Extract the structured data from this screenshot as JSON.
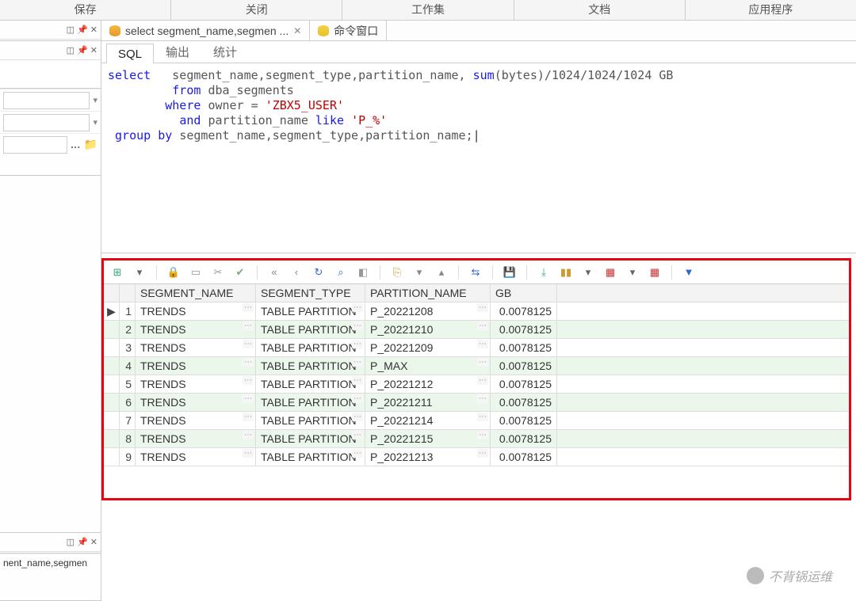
{
  "menubar": [
    "保存",
    "关闭",
    "工作集",
    "文档",
    "应用程序"
  ],
  "doc_tabs": [
    {
      "label": "select segment_name,segmen ...",
      "active": true,
      "closable": true
    },
    {
      "label": "命令窗口",
      "active": false,
      "closable": false
    }
  ],
  "sub_tabs": [
    {
      "label": "SQL",
      "active": true
    },
    {
      "label": "输出",
      "active": false
    },
    {
      "label": "统计",
      "active": false
    }
  ],
  "sql_tokens": [
    {
      "t": "kw",
      "v": "select"
    },
    {
      "t": "sp",
      "v": "   "
    },
    {
      "t": "ident",
      "v": "segment_name"
    },
    {
      "t": "lit",
      "v": ","
    },
    {
      "t": "ident",
      "v": "segment_type"
    },
    {
      "t": "lit",
      "v": ","
    },
    {
      "t": "ident",
      "v": "partition_name"
    },
    {
      "t": "lit",
      "v": ", "
    },
    {
      "t": "func",
      "v": "sum"
    },
    {
      "t": "lit",
      "v": "("
    },
    {
      "t": "ident",
      "v": "bytes"
    },
    {
      "t": "lit",
      "v": ")"
    },
    {
      "t": "lit",
      "v": "/"
    },
    {
      "t": "lit",
      "v": "1024"
    },
    {
      "t": "lit",
      "v": "/"
    },
    {
      "t": "lit",
      "v": "1024"
    },
    {
      "t": "lit",
      "v": "/"
    },
    {
      "t": "lit",
      "v": "1024"
    },
    {
      "t": "sp",
      "v": " "
    },
    {
      "t": "ident",
      "v": "GB"
    },
    {
      "t": "nl",
      "v": "\n"
    },
    {
      "t": "sp",
      "v": "         "
    },
    {
      "t": "kw",
      "v": "from"
    },
    {
      "t": "sp",
      "v": " "
    },
    {
      "t": "ident",
      "v": "dba_segments"
    },
    {
      "t": "nl",
      "v": "\n"
    },
    {
      "t": "sp",
      "v": "        "
    },
    {
      "t": "kw",
      "v": "where"
    },
    {
      "t": "sp",
      "v": " "
    },
    {
      "t": "ident",
      "v": "owner"
    },
    {
      "t": "sp",
      "v": " "
    },
    {
      "t": "lit",
      "v": "="
    },
    {
      "t": "sp",
      "v": " "
    },
    {
      "t": "str",
      "v": "'ZBX5_USER'"
    },
    {
      "t": "nl",
      "v": "\n"
    },
    {
      "t": "sp",
      "v": "          "
    },
    {
      "t": "kw",
      "v": "and"
    },
    {
      "t": "sp",
      "v": " "
    },
    {
      "t": "ident",
      "v": "partition_name"
    },
    {
      "t": "sp",
      "v": " "
    },
    {
      "t": "kw",
      "v": "like"
    },
    {
      "t": "sp",
      "v": " "
    },
    {
      "t": "str",
      "v": "'P_%'"
    },
    {
      "t": "nl",
      "v": "\n"
    },
    {
      "t": "sp",
      "v": " "
    },
    {
      "t": "kw",
      "v": "group"
    },
    {
      "t": "sp",
      "v": " "
    },
    {
      "t": "kw",
      "v": "by"
    },
    {
      "t": "sp",
      "v": " "
    },
    {
      "t": "ident",
      "v": "segment_name"
    },
    {
      "t": "lit",
      "v": ","
    },
    {
      "t": "ident",
      "v": "segment_type"
    },
    {
      "t": "lit",
      "v": ","
    },
    {
      "t": "ident",
      "v": "partition_name"
    },
    {
      "t": "lit",
      "v": ";"
    }
  ],
  "grid": {
    "columns": [
      "SEGMENT_NAME",
      "SEGMENT_TYPE",
      "PARTITION_NAME",
      "GB"
    ],
    "rows": [
      {
        "n": 1,
        "marker": "▶",
        "c": [
          "TRENDS",
          "TABLE PARTITION",
          "P_20221208",
          "0.0078125"
        ]
      },
      {
        "n": 2,
        "marker": "",
        "c": [
          "TRENDS",
          "TABLE PARTITION",
          "P_20221210",
          "0.0078125"
        ]
      },
      {
        "n": 3,
        "marker": "",
        "c": [
          "TRENDS",
          "TABLE PARTITION",
          "P_20221209",
          "0.0078125"
        ]
      },
      {
        "n": 4,
        "marker": "",
        "c": [
          "TRENDS",
          "TABLE PARTITION",
          "P_MAX",
          "0.0078125"
        ]
      },
      {
        "n": 5,
        "marker": "",
        "c": [
          "TRENDS",
          "TABLE PARTITION",
          "P_20221212",
          "0.0078125"
        ]
      },
      {
        "n": 6,
        "marker": "",
        "c": [
          "TRENDS",
          "TABLE PARTITION",
          "P_20221211",
          "0.0078125"
        ]
      },
      {
        "n": 7,
        "marker": "",
        "c": [
          "TRENDS",
          "TABLE PARTITION",
          "P_20221214",
          "0.0078125"
        ]
      },
      {
        "n": 8,
        "marker": "",
        "c": [
          "TRENDS",
          "TABLE PARTITION",
          "P_20221215",
          "0.0078125"
        ]
      },
      {
        "n": 9,
        "marker": "",
        "c": [
          "TRENDS",
          "TABLE PARTITION",
          "P_20221213",
          "0.0078125"
        ]
      }
    ]
  },
  "left_truncated": "nent_name,segmen",
  "toolbar_icons": [
    {
      "name": "grid-icon",
      "glyph": "⊞",
      "color": "#3a7"
    },
    {
      "name": "dropdown-icon",
      "glyph": "▾",
      "color": "#666"
    },
    "|",
    {
      "name": "lock-icon",
      "glyph": "🔒",
      "color": "#c33"
    },
    {
      "name": "page-icon",
      "glyph": "▭",
      "color": "#999"
    },
    {
      "name": "cut-icon",
      "glyph": "✂",
      "color": "#999"
    },
    {
      "name": "check-icon",
      "glyph": "✔",
      "color": "#7a7"
    },
    "|",
    {
      "name": "first-icon",
      "glyph": "«",
      "color": "#888"
    },
    {
      "name": "prev-icon",
      "glyph": "‹",
      "color": "#888"
    },
    {
      "name": "refresh-icon",
      "glyph": "↻",
      "color": "#36c"
    },
    {
      "name": "find-icon",
      "glyph": "⌕",
      "color": "#36c"
    },
    {
      "name": "erase-icon",
      "glyph": "◧",
      "color": "#999"
    },
    "|",
    {
      "name": "copy-icon",
      "glyph": "⎘",
      "color": "#c93"
    },
    {
      "name": "down-icon",
      "glyph": "▾",
      "color": "#888"
    },
    {
      "name": "up-icon",
      "glyph": "▴",
      "color": "#888"
    },
    "|",
    {
      "name": "link-icon",
      "glyph": "⇆",
      "color": "#36c"
    },
    "|",
    {
      "name": "save-icon",
      "glyph": "💾",
      "color": "#36c"
    },
    "|",
    {
      "name": "export-icon",
      "glyph": "⤓",
      "color": "#3a7"
    },
    {
      "name": "chart-icon",
      "glyph": "▮▮",
      "color": "#c93"
    },
    {
      "name": "dropdown2-icon",
      "glyph": "▾",
      "color": "#666"
    },
    {
      "name": "table-icon",
      "glyph": "▦",
      "color": "#c33"
    },
    {
      "name": "dropdown3-icon",
      "glyph": "▾",
      "color": "#666"
    },
    {
      "name": "grid2-icon",
      "glyph": "▦",
      "color": "#c33"
    },
    "|",
    {
      "name": "filter-icon",
      "glyph": "▼",
      "color": "#36c"
    }
  ],
  "watermark": "不背锅运维"
}
